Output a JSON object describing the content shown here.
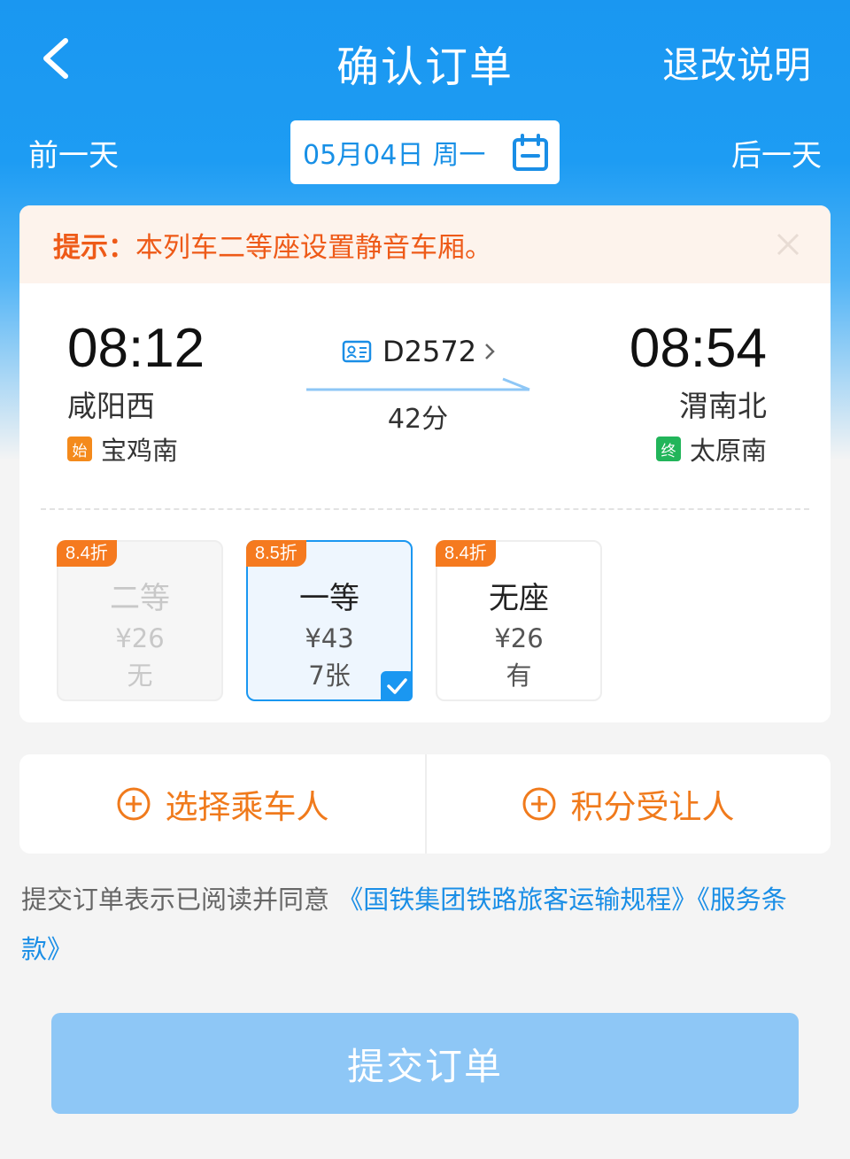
{
  "header": {
    "title": "确认订单",
    "refund_link": "退改说明"
  },
  "date_bar": {
    "prev_day": "前一天",
    "next_day": "后一天",
    "date": "05月04日",
    "weekday": "周一"
  },
  "notice": {
    "label": "提示：",
    "text": "本列车二等座设置静音车厢。"
  },
  "train": {
    "number": "D2572",
    "duration": "42分",
    "departure": {
      "time": "08:12",
      "station": "咸阳西",
      "origin_badge": "始",
      "origin": "宝鸡南"
    },
    "arrival": {
      "time": "08:54",
      "station": "渭南北",
      "terminal_badge": "终",
      "terminal": "太原南"
    }
  },
  "seats": [
    {
      "discount": "8.4折",
      "name": "二等",
      "price": "¥26",
      "availability": "无",
      "state": "disabled"
    },
    {
      "discount": "8.5折",
      "name": "一等",
      "price": "¥43",
      "availability": "7张",
      "state": "selected"
    },
    {
      "discount": "8.4折",
      "name": "无座",
      "price": "¥26",
      "availability": "有",
      "state": "normal"
    }
  ],
  "actions": {
    "select_passenger": "选择乘车人",
    "points_recipient": "积分受让人"
  },
  "agreement": {
    "prefix": "提交订单表示已阅读并同意",
    "link1": "《国铁集团铁路旅客运输规程》",
    "link2": "《服务条款》"
  },
  "submit_label": "提交订单",
  "colors": {
    "brand_blue": "#1a97f1",
    "accent_orange": "#f07a1c",
    "notice_orange": "#ee5a18",
    "submit_disabled": "#8ec7f6"
  }
}
